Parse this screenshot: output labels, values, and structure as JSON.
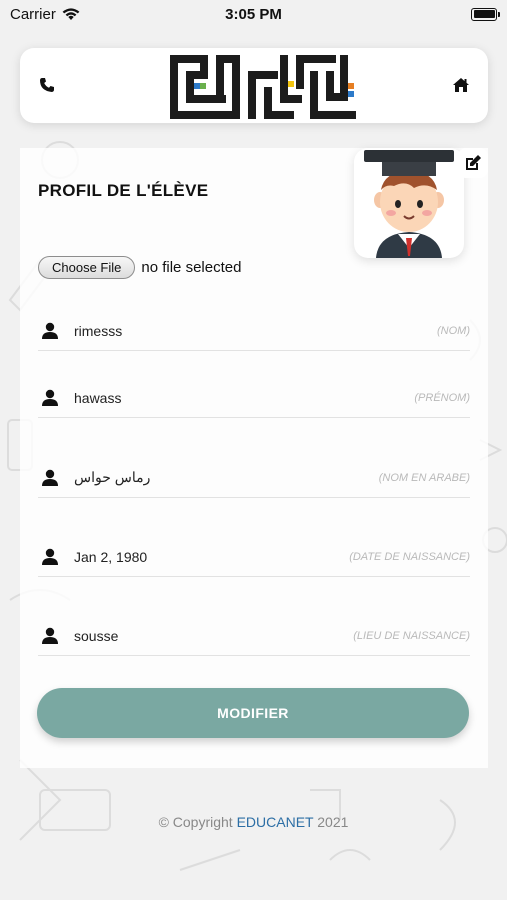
{
  "status_bar": {
    "carrier": "Carrier",
    "time": "3:05 PM"
  },
  "header": {
    "logo_icon": "kufic-calligraphy-logo",
    "phone_icon": "phone-icon",
    "home_icon": "home-icon"
  },
  "profile": {
    "title": "PROFIL DE L'ÉLÈVE",
    "avatar_icon": "student-avatar",
    "edit_icon": "edit-icon"
  },
  "file_upload": {
    "button_label": "Choose File",
    "status": "no file selected"
  },
  "fields": [
    {
      "value": "rimesss",
      "label": "(NOM)"
    },
    {
      "value": "hawass",
      "label": "(PRÉNOM)"
    },
    {
      "value": "رماس حواس",
      "label": "(NOM EN ARABE)"
    },
    {
      "value": "Jan 2, 1980",
      "label": "(DATE DE NAISSANCE)"
    },
    {
      "value": "sousse",
      "label": "(LIEU DE NAISSANCE)"
    }
  ],
  "submit": {
    "label": "MODIFIER"
  },
  "footer": {
    "prefix": "© Copyright",
    "brand": "EDUCANET",
    "year": "2021"
  },
  "colors": {
    "accent": "#7aa8a2",
    "brand_link": "#2c6ea5",
    "label_gray": "#b9b9b9"
  }
}
